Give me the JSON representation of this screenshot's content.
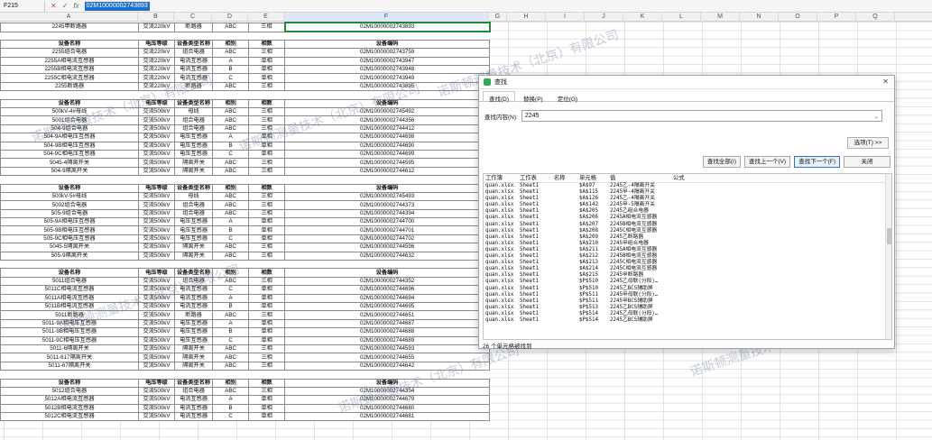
{
  "formula_bar": {
    "cell_ref": "F215",
    "cancel_icon": "✕",
    "confirm_icon": "✓",
    "fx_label": "fx",
    "value": "02M10000002743893"
  },
  "columns": [
    "A",
    "B",
    "C",
    "D",
    "E",
    "F",
    "G",
    "H",
    "I",
    "J",
    "K",
    "L",
    "M",
    "N",
    "O",
    "P",
    "Q"
  ],
  "selected_column": "F",
  "sheet_rows": [
    {
      "type": "data",
      "a": "2245甲断路器",
      "b": "交流220kV",
      "c": "断路器",
      "d": "ABC",
      "e": "三相",
      "f": "02M10000002743893",
      "sel": true
    },
    {
      "type": "gap"
    },
    {
      "type": "header",
      "a": "设备名称",
      "b": "电压等级",
      "c": "设备类型名称",
      "d": "相别",
      "e": "相数",
      "f": "设备编码"
    },
    {
      "type": "data",
      "a": "2255组合电器",
      "b": "交流220kV",
      "c": "组合电器",
      "d": "ABC",
      "e": "三相",
      "f": "02M10000002743759"
    },
    {
      "type": "data",
      "a": "2255A相电流互感器",
      "b": "交流220kV",
      "c": "电流互感器",
      "d": "A",
      "e": "单相",
      "f": "02M10000002743947"
    },
    {
      "type": "data",
      "a": "2255B相电流互感器",
      "b": "交流220kV",
      "c": "电流互感器",
      "d": "B",
      "e": "单相",
      "f": "02M10000002743948"
    },
    {
      "type": "data",
      "a": "2255C相电流互感器",
      "b": "交流220kV",
      "c": "电流互感器",
      "d": "C",
      "e": "单相",
      "f": "02M10000002743949"
    },
    {
      "type": "data",
      "a": "2255断路器",
      "b": "交流220kV",
      "c": "断路器",
      "d": "ABC",
      "e": "三相",
      "f": "02M10000002743895"
    },
    {
      "type": "gap"
    },
    {
      "type": "header",
      "a": "设备名称",
      "b": "电压等级",
      "c": "设备类型名称",
      "d": "相别",
      "e": "相数",
      "f": "设备编码"
    },
    {
      "type": "data",
      "a": "500kV-4#母线",
      "b": "交流500kV",
      "c": "母线",
      "d": "ABC",
      "e": "三相",
      "f": "02M10000002745492"
    },
    {
      "type": "data",
      "a": "5001组合电器",
      "b": "交流500kV",
      "c": "组合电器",
      "d": "ABC",
      "e": "三相",
      "f": "02M10000002744356"
    },
    {
      "type": "data",
      "a": "504-9组合电器",
      "b": "交流500kV",
      "c": "组合电器",
      "d": "ABC",
      "e": "三相",
      "f": "02M10000002744412"
    },
    {
      "type": "data",
      "a": "504-9A相电压互感器",
      "b": "交流500kV",
      "c": "电压互感器",
      "d": "A",
      "e": "单相",
      "f": "02M10000002744698"
    },
    {
      "type": "data",
      "a": "504-9B相电压互感器",
      "b": "交流500kV",
      "c": "电压互感器",
      "d": "B",
      "e": "单相",
      "f": "02M10000002744690"
    },
    {
      "type": "data",
      "a": "504-9C相电压互感器",
      "b": "交流500kV",
      "c": "电压互感器",
      "d": "C",
      "e": "单相",
      "f": "02M10000002744699"
    },
    {
      "type": "data",
      "a": "5045-4隔离开关",
      "b": "交流500kV",
      "c": "隔离开关",
      "d": "ABC",
      "e": "三相",
      "f": "02M10000002744595"
    },
    {
      "type": "data",
      "a": "504-9隔离开关",
      "b": "交流500kV",
      "c": "隔离开关",
      "d": "ABC",
      "e": "三相",
      "f": "02M10000002744612"
    },
    {
      "type": "gap"
    },
    {
      "type": "header",
      "a": "设备名称",
      "b": "电压等级",
      "c": "设备类型名称",
      "d": "相别",
      "e": "相数",
      "f": "设备编码"
    },
    {
      "type": "data",
      "a": "500kV-5#母线",
      "b": "交流500kV",
      "c": "母线",
      "d": "ABC",
      "e": "三相",
      "f": "02M10000002745493"
    },
    {
      "type": "data",
      "a": "5002组合电器",
      "b": "交流500kV",
      "c": "组合电器",
      "d": "ABC",
      "e": "三相",
      "f": "02M10000002744373"
    },
    {
      "type": "data",
      "a": "505-9组合电器",
      "b": "交流500kV",
      "c": "组合电器",
      "d": "ABC",
      "e": "三相",
      "f": "02M10000002744394"
    },
    {
      "type": "data",
      "a": "505-9A相电压互感器",
      "b": "交流500kV",
      "c": "电压互感器",
      "d": "A",
      "e": "单相",
      "f": "02M10000002744700"
    },
    {
      "type": "data",
      "a": "505-9B相电压互感器",
      "b": "交流500kV",
      "c": "电压互感器",
      "d": "B",
      "e": "单相",
      "f": "02M10000002744701"
    },
    {
      "type": "data",
      "a": "505-9C相电压互感器",
      "b": "交流500kV",
      "c": "电压互感器",
      "d": "C",
      "e": "单相",
      "f": "02M10000002744702"
    },
    {
      "type": "data",
      "a": "5045-5隔离开关",
      "b": "交流500kV",
      "c": "隔离开关",
      "d": "ABC",
      "e": "三相",
      "f": "02M10000002744596"
    },
    {
      "type": "data",
      "a": "505-9隔离开关",
      "b": "交流500kV",
      "c": "隔离开关",
      "d": "ABC",
      "e": "三相",
      "f": "02M10000002744632"
    },
    {
      "type": "gap"
    },
    {
      "type": "header",
      "a": "设备名称",
      "b": "电压等级",
      "c": "设备类型名称",
      "d": "相别",
      "e": "相数",
      "f": "设备编码"
    },
    {
      "type": "data",
      "a": "5011组合电器",
      "b": "交流500kV",
      "c": "组合电器",
      "d": "ABC",
      "e": "三相",
      "f": "02M10000002744352"
    },
    {
      "type": "data",
      "a": "5011C相电流互感器",
      "b": "交流500kV",
      "c": "电流互感器",
      "d": "C",
      "e": "单相",
      "f": "02M10000002744696"
    },
    {
      "type": "data",
      "a": "5011A相电流互感器",
      "b": "交流500kV",
      "c": "电流互感器",
      "d": "A",
      "e": "单相",
      "f": "02M10000002744694"
    },
    {
      "type": "data",
      "a": "5011B相电流互感器",
      "b": "交流500kV",
      "c": "电流互感器",
      "d": "B",
      "e": "单相",
      "f": "02M10000002744695"
    },
    {
      "type": "data",
      "a": "5011断路器",
      "b": "交流500kV",
      "c": "断路器",
      "d": "ABC",
      "e": "三相",
      "f": "02M10000002744651"
    },
    {
      "type": "data",
      "a": "5011-9A相电压互感器",
      "b": "交流500kV",
      "c": "电压互感器",
      "d": "A",
      "e": "单相",
      "f": "02M10000002744687"
    },
    {
      "type": "data",
      "a": "5011-9B相电压互感器",
      "b": "交流500kV",
      "c": "电压互感器",
      "d": "B",
      "e": "单相",
      "f": "02M10000002744688"
    },
    {
      "type": "data",
      "a": "5011-9C相电压互感器",
      "b": "交流500kV",
      "c": "电压互感器",
      "d": "C",
      "e": "单相",
      "f": "02M10000002744689"
    },
    {
      "type": "data",
      "a": "5011-6隔离开关",
      "b": "交流500kV",
      "c": "隔离开关",
      "d": "ABC",
      "e": "三相",
      "f": "02M10000002744593"
    },
    {
      "type": "data",
      "a": "5011-617隔离开关",
      "b": "交流500kV",
      "c": "隔离开关",
      "d": "ABC",
      "e": "三相",
      "f": "02M10000002744655"
    },
    {
      "type": "data",
      "a": "5011-67隔离开关",
      "b": "交流500kV",
      "c": "隔离开关",
      "d": "ABC",
      "e": "三相",
      "f": "02M10000002744642"
    },
    {
      "type": "gap"
    },
    {
      "type": "header",
      "a": "设备名称",
      "b": "电压等级",
      "c": "设备类型名称",
      "d": "相别",
      "e": "相数",
      "f": "设备编码"
    },
    {
      "type": "data",
      "a": "5012组合电器",
      "b": "交流500kV",
      "c": "组合电器",
      "d": "ABC",
      "e": "三相",
      "f": "02M10000002744354"
    },
    {
      "type": "data",
      "a": "5012A相电流互感器",
      "b": "交流500kV",
      "c": "电流互感器",
      "d": "A",
      "e": "单相",
      "f": "02M10000002744679"
    },
    {
      "type": "data",
      "a": "5012B相电流互感器",
      "b": "交流500kV",
      "c": "电流互感器",
      "d": "B",
      "e": "单相",
      "f": "02M10000002744680"
    },
    {
      "type": "data",
      "a": "5012C相电流互感器",
      "b": "交流500kV",
      "c": "电流互感器",
      "d": "C",
      "e": "单相",
      "f": "02M10000002744681"
    }
  ],
  "watermark": "诺斯顿测量技术（北京）有限公司",
  "dialog": {
    "title": "查找",
    "close_icon": "✕",
    "tabs": [
      "查找(D)",
      "替换(P)",
      "定位(G)"
    ],
    "find_label": "查找内容(N):",
    "find_value": "2245",
    "options_btn": "选项(T) >>",
    "find_all": "查找全部(I)",
    "find_prev": "查找上一个(V)",
    "find_next": "查找下一个(F)",
    "close_btn": "关闭",
    "result_headers": [
      "工作簿",
      "工作表",
      "名称",
      "单元格",
      "值",
      "公式"
    ],
    "results": [
      [
        "quan.xlsx",
        "Sheet1",
        "",
        "$A$97",
        "2245乙-4隔离开关"
      ],
      [
        "quan.xlsx",
        "Sheet1",
        "",
        "$A$115",
        "2245甲-4隔离开关"
      ],
      [
        "quan.xlsx",
        "Sheet1",
        "",
        "$A$126",
        "2245乙-4隔离开关"
      ],
      [
        "quan.xlsx",
        "Sheet1",
        "",
        "$A$142",
        "2245甲-5隔离开关"
      ],
      [
        "quan.xlsx",
        "Sheet1",
        "",
        "$A$205",
        "2245乙组合电器"
      ],
      [
        "quan.xlsx",
        "Sheet1",
        "",
        "$A$206",
        "2245A相电流互感器"
      ],
      [
        "quan.xlsx",
        "Sheet1",
        "",
        "$A$207",
        "2245B相电流互感器"
      ],
      [
        "quan.xlsx",
        "Sheet1",
        "",
        "$A$208",
        "2245C相电流互感器"
      ],
      [
        "quan.xlsx",
        "Sheet1",
        "",
        "$A$209",
        "2245乙断路器"
      ],
      [
        "quan.xlsx",
        "Sheet1",
        "",
        "$A$210",
        "2245甲组合电器"
      ],
      [
        "quan.xlsx",
        "Sheet1",
        "",
        "$A$211",
        "2245A相电流互感器"
      ],
      [
        "quan.xlsx",
        "Sheet1",
        "",
        "$A$212",
        "2245B相电流互感器"
      ],
      [
        "quan.xlsx",
        "Sheet1",
        "",
        "$A$213",
        "2245C相电流互感器"
      ],
      [
        "quan.xlsx",
        "Sheet1",
        "",
        "$A$214",
        "2245C相电流互感器"
      ],
      [
        "quan.xlsx",
        "Sheet1",
        "",
        "$A$215",
        "2245甲断路器"
      ],
      [
        "quan.xlsx",
        "Sheet1",
        "",
        "$P$510",
        "2245乙母联(分段)…"
      ],
      [
        "quan.xlsx",
        "Sheet1",
        "",
        "$P$510",
        "2245乙BCS辅助屏"
      ],
      [
        "quan.xlsx",
        "Sheet1",
        "",
        "$P$511",
        "2245甲母联(分段)…"
      ],
      [
        "quan.xlsx",
        "Sheet1",
        "",
        "$P$511",
        "2245甲BCS辅助屏"
      ],
      [
        "quan.xlsx",
        "Sheet1",
        "",
        "$P$513",
        "2245乙BCS辅助屏"
      ],
      [
        "quan.xlsx",
        "Sheet1",
        "",
        "$P$514",
        "2245乙母联(分段)…"
      ],
      [
        "quan.xlsx",
        "Sheet1",
        "",
        "$P$514",
        "2245乙BCS辅助屏"
      ]
    ],
    "status": "26 个单元格被找到"
  }
}
